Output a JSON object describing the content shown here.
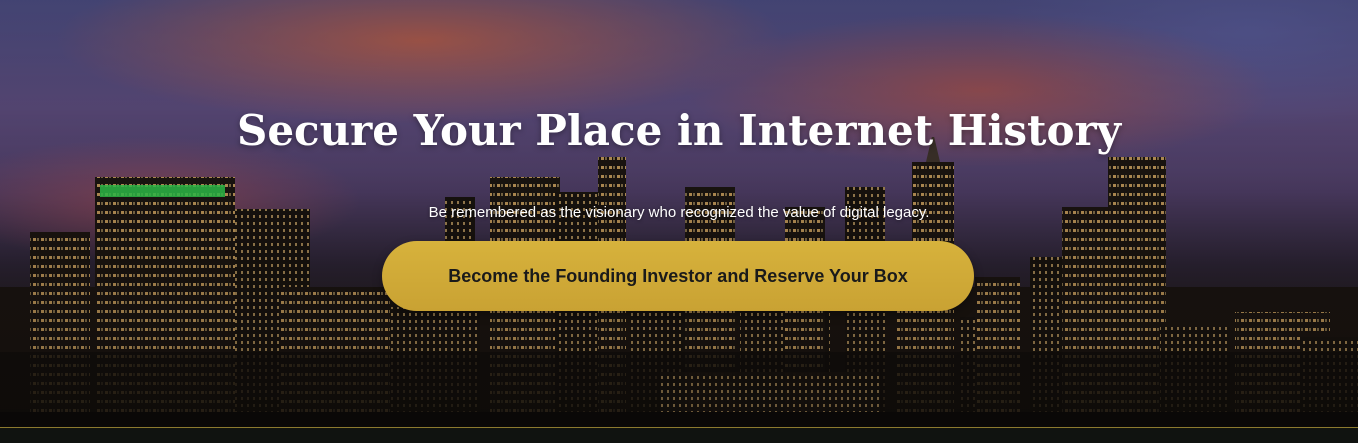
{
  "hero": {
    "title": "Secure Your Place in Internet History",
    "subtitle": "Be remembered as the visionary who recognized the value of digital legacy.",
    "cta_label": "Become the Founding Investor and Reserve Your Box",
    "background": "city-skyline-at-dusk-image"
  },
  "colors": {
    "accent": "#d4ad3a",
    "text": "#ffffff",
    "cta_text": "#1a1a1a"
  }
}
